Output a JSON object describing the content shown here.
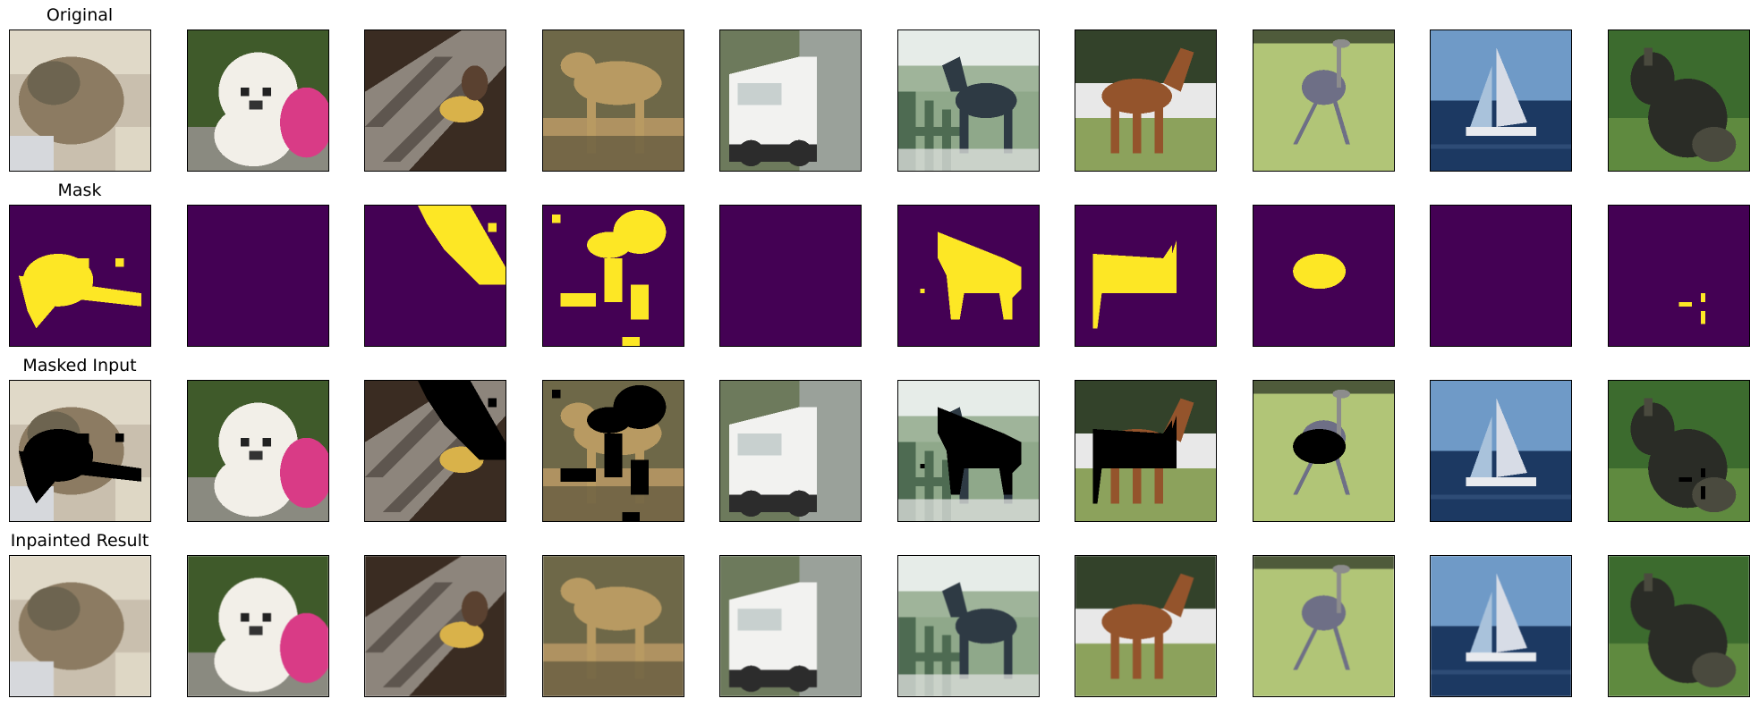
{
  "figure": {
    "rows": [
      {
        "title": "Original",
        "kind": "photo",
        "panels": [
          {
            "subject": "cat-image",
            "palette": [
              "#c9bfae",
              "#8c7b62",
              "#6d6450",
              "#e0d9c8"
            ]
          },
          {
            "subject": "puppy-image",
            "palette": [
              "#3f5a2a",
              "#f2efe8",
              "#d93b86",
              "#8a8a80"
            ]
          },
          {
            "subject": "bird-on-stairs-image",
            "palette": [
              "#3a2c22",
              "#8d857c",
              "#5e564f",
              "#d9b24a"
            ]
          },
          {
            "subject": "deer-image",
            "palette": [
              "#6e6848",
              "#b89a62",
              "#4f4b35",
              "#caa46c"
            ]
          },
          {
            "subject": "truck-image",
            "palette": [
              "#6d7a5c",
              "#f2f2f0",
              "#2c2c2c",
              "#9aa19a"
            ]
          },
          {
            "subject": "horse-at-fence-image",
            "palette": [
              "#e6ece8",
              "#4e6b52",
              "#2e3a44",
              "#8fa88a"
            ]
          },
          {
            "subject": "brown-horse-image",
            "palette": [
              "#33422a",
              "#94542c",
              "#e8e8e8",
              "#8ca25c"
            ]
          },
          {
            "subject": "ostrich-image",
            "palette": [
              "#b1c577",
              "#4f5b3b",
              "#6e6f86",
              "#9eb36b"
            ]
          },
          {
            "subject": "sailboat-image",
            "palette": [
              "#6f9ac7",
              "#1c3962",
              "#d7dce6",
              "#a9c2db"
            ]
          },
          {
            "subject": "dark-animal-image",
            "palette": [
              "#3c6b2e",
              "#2a2c26",
              "#4a4a3e",
              "#5f8a3f"
            ]
          }
        ]
      },
      {
        "title": "Mask",
        "kind": "mask",
        "colors": {
          "background": "#440154",
          "mask": "#fde725"
        },
        "panels": [
          {
            "subject": "mask-cat"
          },
          {
            "subject": "mask-puppy-empty"
          },
          {
            "subject": "mask-bird"
          },
          {
            "subject": "mask-deer"
          },
          {
            "subject": "mask-truck-empty"
          },
          {
            "subject": "mask-horse-at-fence"
          },
          {
            "subject": "mask-brown-horse"
          },
          {
            "subject": "mask-ostrich"
          },
          {
            "subject": "mask-sailboat-empty"
          },
          {
            "subject": "mask-dark-animal"
          }
        ]
      },
      {
        "title": "Masked Input",
        "kind": "masked",
        "colors": {
          "masked_fill": "#000000"
        },
        "panels": [
          {
            "subject": "masked-cat"
          },
          {
            "subject": "masked-puppy"
          },
          {
            "subject": "masked-bird"
          },
          {
            "subject": "masked-deer"
          },
          {
            "subject": "masked-truck"
          },
          {
            "subject": "masked-horse-at-fence"
          },
          {
            "subject": "masked-brown-horse"
          },
          {
            "subject": "masked-ostrich"
          },
          {
            "subject": "masked-sailboat"
          },
          {
            "subject": "masked-dark-animal"
          }
        ]
      },
      {
        "title": "Inpainted Result",
        "kind": "inpainted",
        "panels": [
          {
            "subject": "inpainted-cat"
          },
          {
            "subject": "inpainted-puppy"
          },
          {
            "subject": "inpainted-bird"
          },
          {
            "subject": "inpainted-deer"
          },
          {
            "subject": "inpainted-truck"
          },
          {
            "subject": "inpainted-horse-at-fence"
          },
          {
            "subject": "inpainted-brown-horse"
          },
          {
            "subject": "inpainted-ostrich"
          },
          {
            "subject": "inpainted-sailboat"
          },
          {
            "subject": "inpainted-dark-animal"
          }
        ]
      }
    ]
  }
}
